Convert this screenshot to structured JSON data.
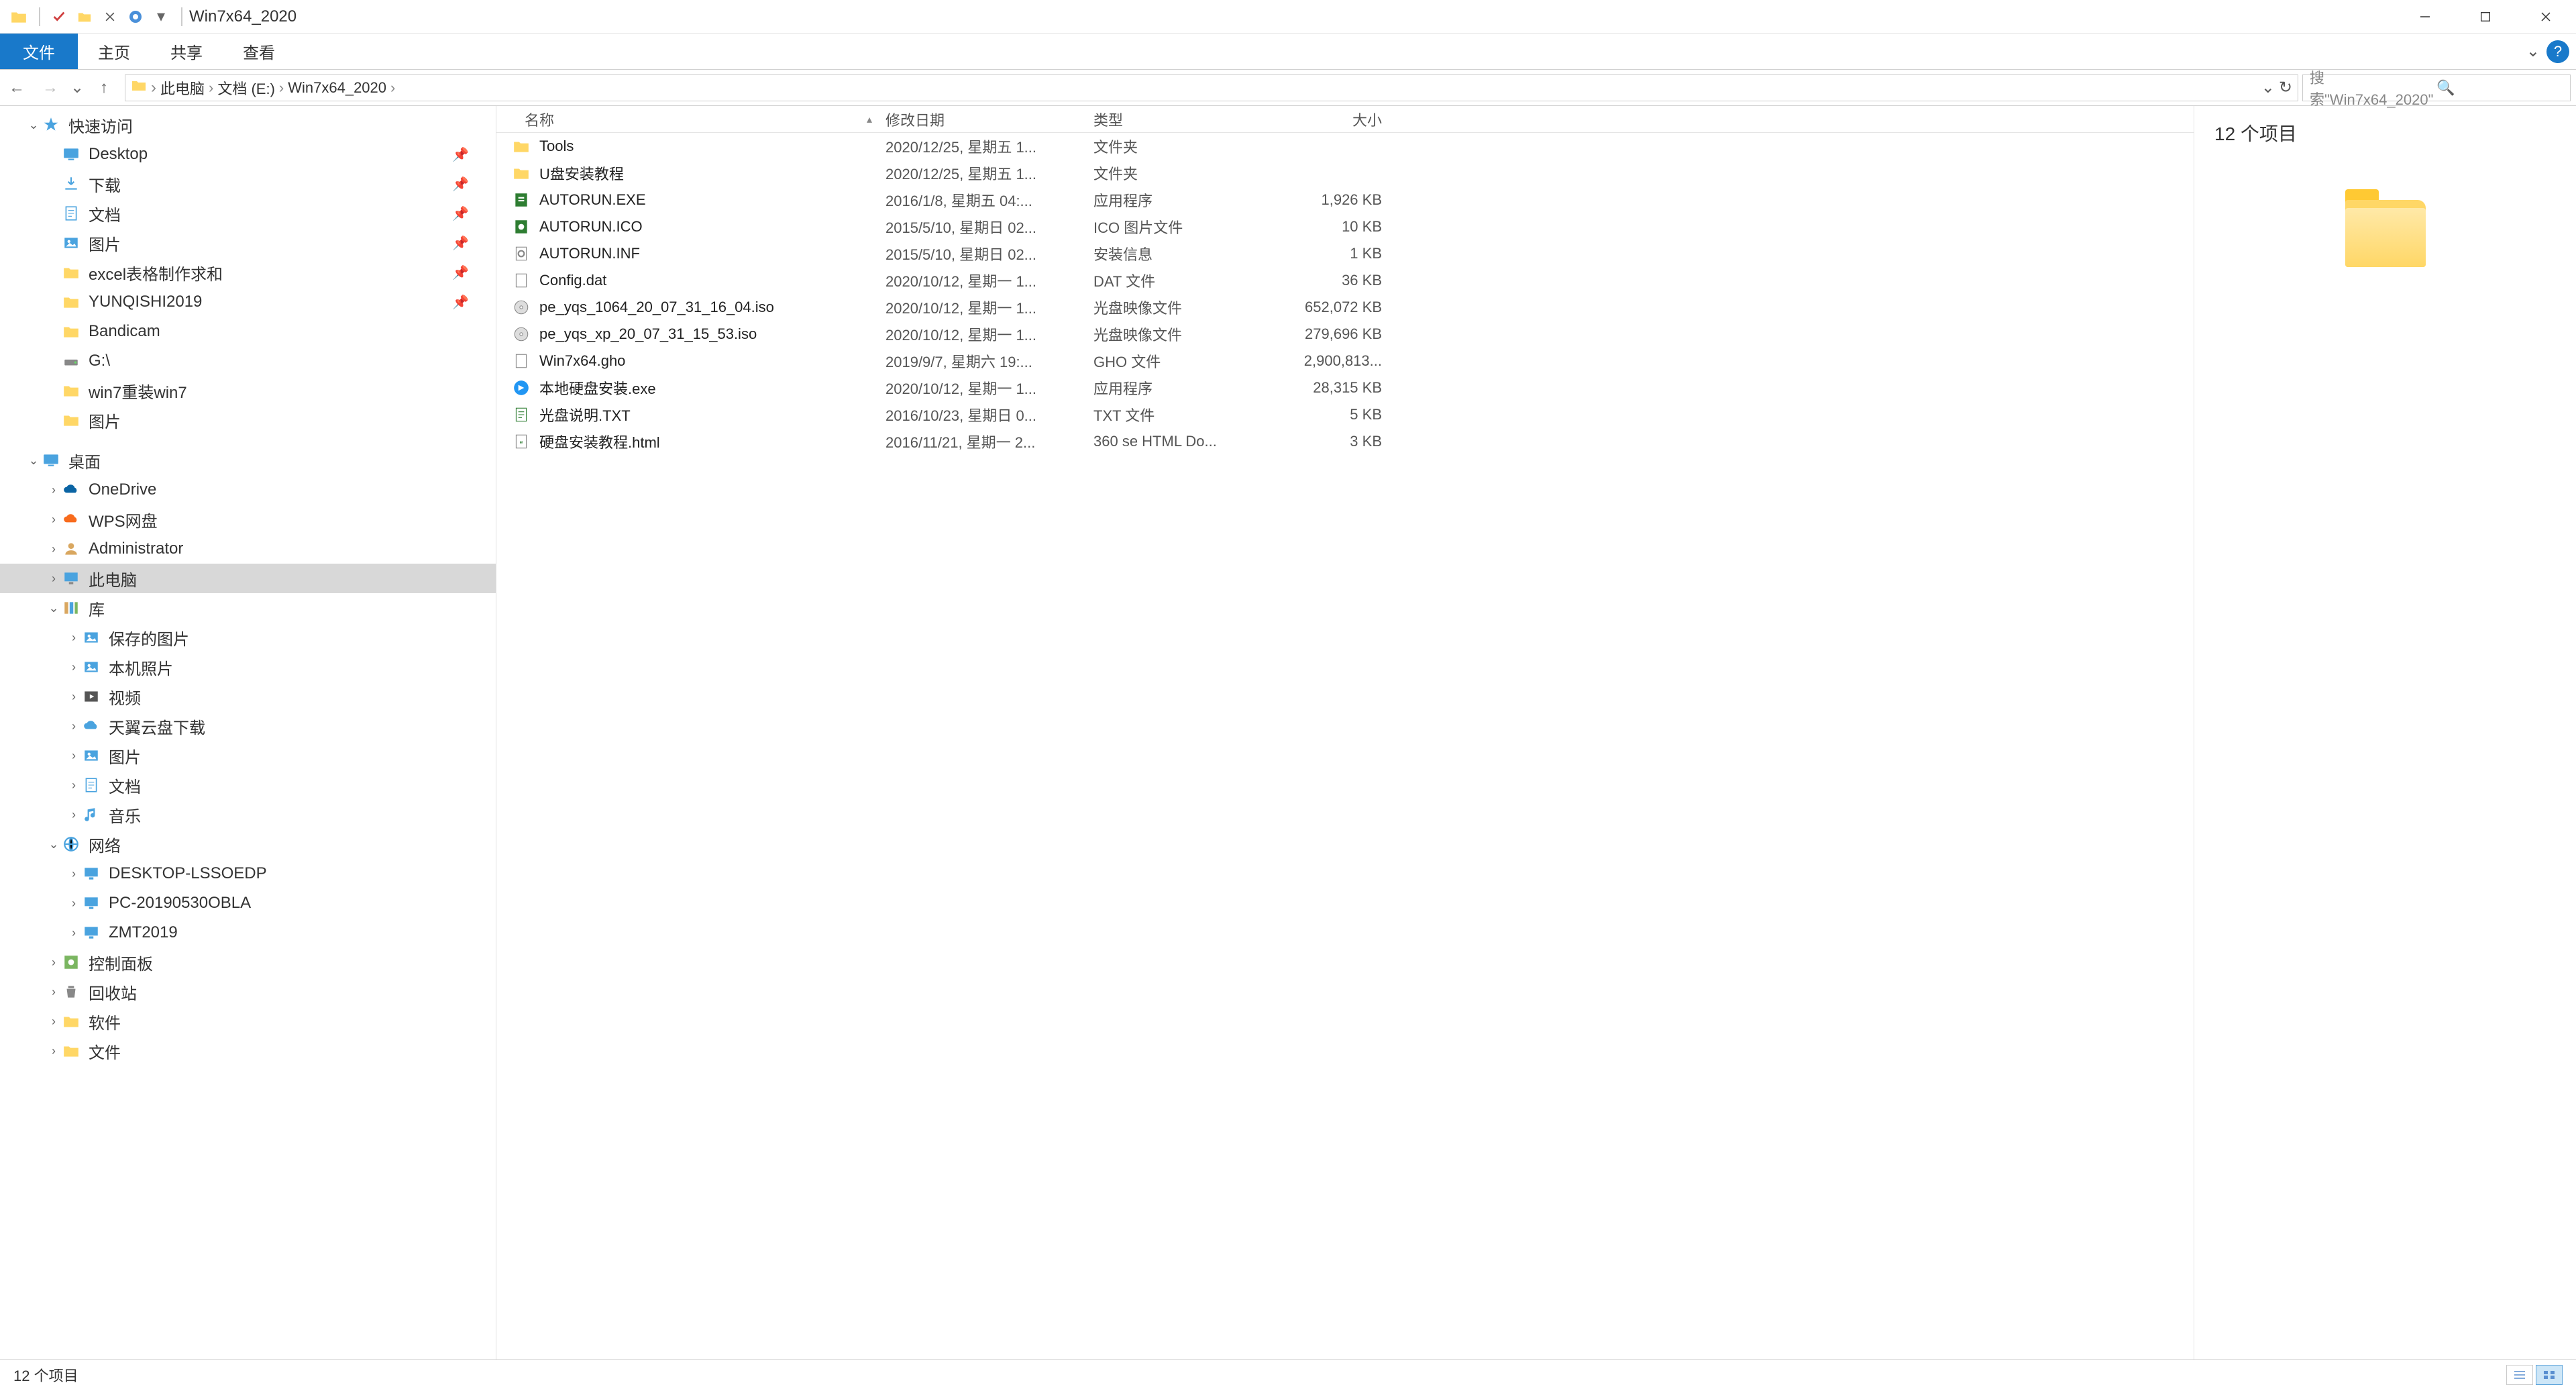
{
  "title": "Win7x64_2020",
  "ribbon": {
    "file": "文件",
    "home": "主页",
    "share": "共享",
    "view": "查看"
  },
  "nav": {
    "crumbs": [
      "此电脑",
      "文档 (E:)",
      "Win7x64_2020"
    ],
    "refresh": "↻",
    "dropdown": "⌄"
  },
  "search_placeholder": "搜索\"Win7x64_2020\"",
  "sidebar": [
    {
      "label": "快速访问",
      "icon": "star",
      "indent": 0,
      "chev": "⌄",
      "pin": false
    },
    {
      "label": "Desktop",
      "icon": "desktop",
      "indent": 1,
      "pin": true
    },
    {
      "label": "下载",
      "icon": "download",
      "indent": 1,
      "pin": true
    },
    {
      "label": "文档",
      "icon": "doc",
      "indent": 1,
      "pin": true
    },
    {
      "label": "图片",
      "icon": "pic",
      "indent": 1,
      "pin": true
    },
    {
      "label": "excel表格制作求和",
      "icon": "folder",
      "indent": 1,
      "pin": true
    },
    {
      "label": "YUNQISHI2019",
      "icon": "folder",
      "indent": 1,
      "pin": true
    },
    {
      "label": "Bandicam",
      "icon": "folder",
      "indent": 1,
      "pin": false
    },
    {
      "label": "G:\\",
      "icon": "drive",
      "indent": 1,
      "pin": false
    },
    {
      "label": "win7重装win7",
      "icon": "folder",
      "indent": 1,
      "pin": false
    },
    {
      "label": "图片",
      "icon": "folder",
      "indent": 1,
      "pin": false
    },
    {
      "label": "桌面",
      "icon": "desktop",
      "indent": 0,
      "chev": "⌄",
      "pin": false,
      "space": true
    },
    {
      "label": "OneDrive",
      "icon": "onedrive",
      "indent": 1,
      "pin": false,
      "chev": "›"
    },
    {
      "label": "WPS网盘",
      "icon": "wps",
      "indent": 1,
      "pin": false,
      "chev": "›"
    },
    {
      "label": "Administrator",
      "icon": "user",
      "indent": 1,
      "pin": false,
      "chev": "›"
    },
    {
      "label": "此电脑",
      "icon": "pc",
      "indent": 1,
      "pin": false,
      "chev": "›",
      "selected": true
    },
    {
      "label": "库",
      "icon": "lib",
      "indent": 1,
      "pin": false,
      "chev": "⌄"
    },
    {
      "label": "保存的图片",
      "icon": "pic",
      "indent": 2,
      "pin": false,
      "chev": "›"
    },
    {
      "label": "本机照片",
      "icon": "pic",
      "indent": 2,
      "pin": false,
      "chev": "›"
    },
    {
      "label": "视频",
      "icon": "video",
      "indent": 2,
      "pin": false,
      "chev": "›"
    },
    {
      "label": "天翼云盘下载",
      "icon": "cloud",
      "indent": 2,
      "pin": false,
      "chev": "›"
    },
    {
      "label": "图片",
      "icon": "pic",
      "indent": 2,
      "pin": false,
      "chev": "›"
    },
    {
      "label": "文档",
      "icon": "doc",
      "indent": 2,
      "pin": false,
      "chev": "›"
    },
    {
      "label": "音乐",
      "icon": "music",
      "indent": 2,
      "pin": false,
      "chev": "›"
    },
    {
      "label": "网络",
      "icon": "net",
      "indent": 1,
      "pin": false,
      "chev": "⌄"
    },
    {
      "label": "DESKTOP-LSSOEDP",
      "icon": "netpc",
      "indent": 2,
      "pin": false,
      "chev": "›"
    },
    {
      "label": "PC-20190530OBLA",
      "icon": "netpc",
      "indent": 2,
      "pin": false,
      "chev": "›"
    },
    {
      "label": "ZMT2019",
      "icon": "netpc",
      "indent": 2,
      "pin": false,
      "chev": "›"
    },
    {
      "label": "控制面板",
      "icon": "cpanel",
      "indent": 1,
      "pin": false,
      "chev": "›"
    },
    {
      "label": "回收站",
      "icon": "recycle",
      "indent": 1,
      "pin": false,
      "chev": "›"
    },
    {
      "label": "软件",
      "icon": "folder",
      "indent": 1,
      "pin": false,
      "chev": "›"
    },
    {
      "label": "文件",
      "icon": "folder",
      "indent": 1,
      "pin": false,
      "chev": "›"
    }
  ],
  "columns": {
    "name": "名称",
    "date": "修改日期",
    "type": "类型",
    "size": "大小"
  },
  "files": [
    {
      "name": "Tools",
      "date": "2020/12/25, 星期五 1...",
      "type": "文件夹",
      "size": "",
      "icon": "folder"
    },
    {
      "name": "U盘安装教程",
      "date": "2020/12/25, 星期五 1...",
      "type": "文件夹",
      "size": "",
      "icon": "folder"
    },
    {
      "name": "AUTORUN.EXE",
      "date": "2016/1/8, 星期五 04:...",
      "type": "应用程序",
      "size": "1,926 KB",
      "icon": "exe"
    },
    {
      "name": "AUTORUN.ICO",
      "date": "2015/5/10, 星期日 02...",
      "type": "ICO 图片文件",
      "size": "10 KB",
      "icon": "ico"
    },
    {
      "name": "AUTORUN.INF",
      "date": "2015/5/10, 星期日 02...",
      "type": "安装信息",
      "size": "1 KB",
      "icon": "ini"
    },
    {
      "name": "Config.dat",
      "date": "2020/10/12, 星期一 1...",
      "type": "DAT 文件",
      "size": "36 KB",
      "icon": "file"
    },
    {
      "name": "pe_yqs_1064_20_07_31_16_04.iso",
      "date": "2020/10/12, 星期一 1...",
      "type": "光盘映像文件",
      "size": "652,072 KB",
      "icon": "iso"
    },
    {
      "name": "pe_yqs_xp_20_07_31_15_53.iso",
      "date": "2020/10/12, 星期一 1...",
      "type": "光盘映像文件",
      "size": "279,696 KB",
      "icon": "iso"
    },
    {
      "name": "Win7x64.gho",
      "date": "2019/9/7, 星期六 19:...",
      "type": "GHO 文件",
      "size": "2,900,813...",
      "icon": "file"
    },
    {
      "name": "本地硬盘安装.exe",
      "date": "2020/10/12, 星期一 1...",
      "type": "应用程序",
      "size": "28,315 KB",
      "icon": "exe2"
    },
    {
      "name": "光盘说明.TXT",
      "date": "2016/10/23, 星期日 0...",
      "type": "TXT 文件",
      "size": "5 KB",
      "icon": "txt"
    },
    {
      "name": "硬盘安装教程.html",
      "date": "2016/11/21, 星期一 2...",
      "type": "360 se HTML Do...",
      "size": "3 KB",
      "icon": "html"
    }
  ],
  "preview": {
    "title": "12 个项目"
  },
  "status": {
    "text": "12 个项目"
  }
}
